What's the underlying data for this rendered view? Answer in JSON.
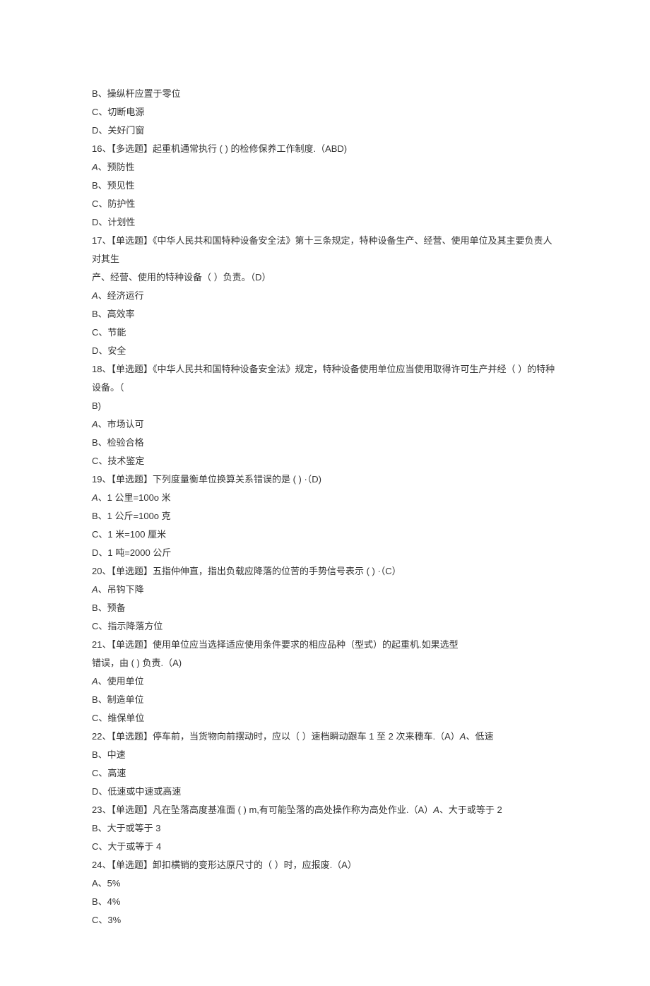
{
  "lines": [
    "B、操纵杆应置于零位",
    "C、切断电源",
    "D、关好门窗",
    "16、【多选题】起重机通常执行 (  ) 的检修保养工作制度.（ABD)",
    "A、预防性",
    "B、预见性",
    "C、防护性",
    "D、计划性",
    "17、【单选题】《中华人民共和国特种设备安全法》第十三条规定，特种设备生产、经营、使用单位及其主要负责人对其生",
    "产、经营、使用的特种设备（ ）负责。（D）",
    "A、经济运行",
    "B、高效率",
    "C、节能",
    "D、安全",
    "18、【单选题】《中华人民共和国特种设备安全法》规定，特种设备使用单位应当使用取得许可生产并经（ ）的特种设备。（",
    "B)",
    "A、市场认可",
    "B、检验合格",
    "C、技术鉴定",
    "19、【单选题】下列度量衡单位换算关系错误的是 (  ) ·（D)",
    "A、1 公里=100o 米",
    "B、1 公斤=100o 克",
    "C、1 米=100 厘米",
    "D、1 吨=2000 公斤",
    "20、【单选题】五指仲伸直，指出负载应降落的位苦的手势信号表示 (  ) ·（C）",
    "A、吊钩下降",
    "B、预备",
    "C、指示降落方位",
    "21、【单选题】使用单位应当选择适应使用条件要求的相应品种（型式）的起重机.如果选型",
    "错误，由 (  ) 负责.（A)",
    "A、使用单位",
    "B、制造单位",
    "C、维保单位",
    "22、【单选题】停车前，当货物向前摆动时，应以（  ）速档瞬动跟车 1 至 2 次来穗车.（A）A、低速",
    "B、中速",
    "C、高速",
    "D、低速或中速或高速",
    "23、【单选题】凡在坠落高度基准面 (  ) m,有可能坠落的高处操作称为高处作业.（A）A、大于或等于 2",
    "B、大于或等于 3",
    "C、大于或等于 4",
    "24、【单选题】卸扣横销的变形达原尺寸的（ ）时，应报废.（A）",
    "A、5%",
    "B、4%",
    "C、3%"
  ]
}
